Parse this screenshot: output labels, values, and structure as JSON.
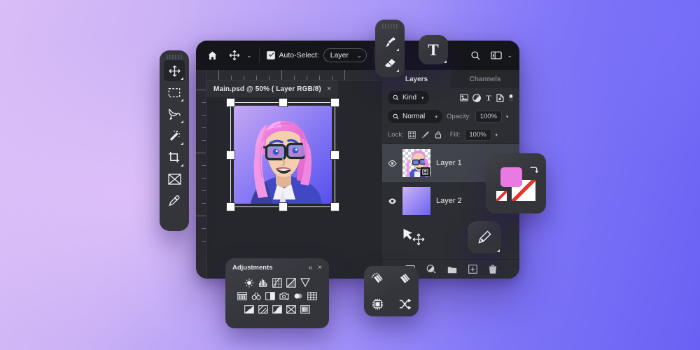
{
  "theme": {
    "bg_gradient_from": "#d9bdf7",
    "bg_gradient_to": "#6a61f4",
    "window_bg": "#1f2024",
    "panel_bg": "#2c2e33",
    "float_bg": "#33353b",
    "accent_pink": "#e97ae2",
    "text_primary": "#e9eaee",
    "text_muted": "#9a9da5"
  },
  "toolbar": {
    "home_icon": "home-icon",
    "move_tool_icon": "move-tool-icon",
    "move_caret": "⌄",
    "auto_select_label": "Auto-Select:",
    "auto_select_checked": true,
    "auto_select_value": "Layer",
    "auto_select_caret": "⌄",
    "search_icon": "search-icon",
    "workspace_icon": "workspace-icon",
    "workspace_caret": "⌄"
  },
  "document": {
    "tab_title": "Main.psd @ 50% ( Layer RGB/8)",
    "close_label": "×",
    "zoom": "50%",
    "color_mode": "RGB/8",
    "active_layer": "Layer"
  },
  "left_tools": {
    "items": [
      {
        "name": "move-tool",
        "label": "Move",
        "icon": "move-tool-icon",
        "active": true,
        "has_flyout": true
      },
      {
        "name": "rectangular-select-tool",
        "label": "Rectangular Select",
        "icon": "marquee-icon",
        "active": false,
        "has_flyout": true
      },
      {
        "name": "lasso-tool",
        "label": "Lasso",
        "icon": "lasso-icon",
        "active": false,
        "has_flyout": true
      },
      {
        "name": "magic-wand-tool",
        "label": "Magic Wand",
        "icon": "magic-wand-icon",
        "active": false,
        "has_flyout": true
      },
      {
        "name": "crop-tool",
        "label": "Crop",
        "icon": "crop-icon",
        "active": false,
        "has_flyout": true
      },
      {
        "name": "frame-tool",
        "label": "Frame",
        "icon": "frame-icon",
        "active": false,
        "has_flyout": false
      },
      {
        "name": "eyedropper-tool",
        "label": "Eyedropper",
        "icon": "eyedropper-icon",
        "active": false,
        "has_flyout": false
      }
    ]
  },
  "floating_tools": {
    "brush_panel": [
      {
        "name": "brush-tool",
        "label": "Brush",
        "icon": "brush-icon"
      },
      {
        "name": "eraser-tool",
        "label": "Eraser",
        "icon": "eraser-icon"
      }
    ],
    "type_tool": {
      "label": "T",
      "icon": "type-tool-icon"
    },
    "pen_tool": {
      "icon": "pen-tool-icon"
    },
    "misc_panel": [
      {
        "name": "blur-tool",
        "icon": "blur-gradient-icon"
      },
      {
        "name": "sharpen-tool",
        "icon": "gradient-bars-icon"
      },
      {
        "name": "neural-filter-tool",
        "icon": "chip-icon"
      },
      {
        "name": "shuffle-tool",
        "icon": "shuffle-icon"
      }
    ],
    "color_swatches": {
      "foreground": "#e97ae2",
      "background": "#ffffff",
      "swap_icon": "swap-arrow-icon"
    }
  },
  "layers_panel": {
    "tabs": [
      {
        "label": "Layers",
        "active": true
      },
      {
        "label": "Channels",
        "active": false
      }
    ],
    "kind_filter": {
      "label": "Kind",
      "icon": "search-icon"
    },
    "filter_icons": [
      "image-filter-icon",
      "adjustment-filter-icon",
      "type-filter-icon",
      "shape-filter-icon",
      "toggle-dot-icon"
    ],
    "blend_mode": {
      "label": "Normal",
      "icon": "search-icon"
    },
    "opacity": {
      "label": "Opacity:",
      "value": "100%",
      "caret": "⌄"
    },
    "lock": {
      "label": "Lock:",
      "icons": [
        "lock-pixels-icon",
        "lock-paint-icon",
        "lock-all-icon"
      ]
    },
    "fill": {
      "label": "Fill:",
      "value": "100%",
      "caret": "⌄"
    },
    "layers": [
      {
        "name": "Layer 1",
        "visible": true,
        "selected": true,
        "thumb_type": "transparent-portrait",
        "badge": "smart-object-icon"
      },
      {
        "name": "Layer 2",
        "visible": true,
        "selected": false,
        "thumb_type": "gradient",
        "badge": ""
      }
    ],
    "footer_icons": [
      "fx-icon",
      "adjustment-icon",
      "new-group-icon",
      "new-layer-icon",
      "delete-layer-icon"
    ],
    "path_cursor_icon": "path-move-cursor-icon"
  },
  "adjustments_panel": {
    "title": "Adjustments",
    "collapse_label": "«",
    "close_label": "×",
    "rows": [
      [
        "brightness-contrast-icon",
        "levels-icon",
        "curves-icon",
        "exposure-icon",
        "vibrance-icon"
      ],
      [
        "hue-saturation-icon",
        "color-balance-icon",
        "black-white-icon",
        "photo-filter-icon",
        "channel-mixer-icon",
        "color-lookup-icon"
      ],
      [
        "invert-icon",
        "posterize-icon",
        "threshold-icon",
        "selective-color-icon",
        "gradient-map-icon"
      ]
    ]
  },
  "artwork": {
    "description": "Illustrated portrait of a woman with long pink hair, dark-framed glasses and a blue jacket",
    "bg_from": "#c3a4f2",
    "bg_to": "#5b55ef",
    "hair": "#ef7fdf",
    "skin": "#f2cdae",
    "jacket": "#3f49c4"
  }
}
